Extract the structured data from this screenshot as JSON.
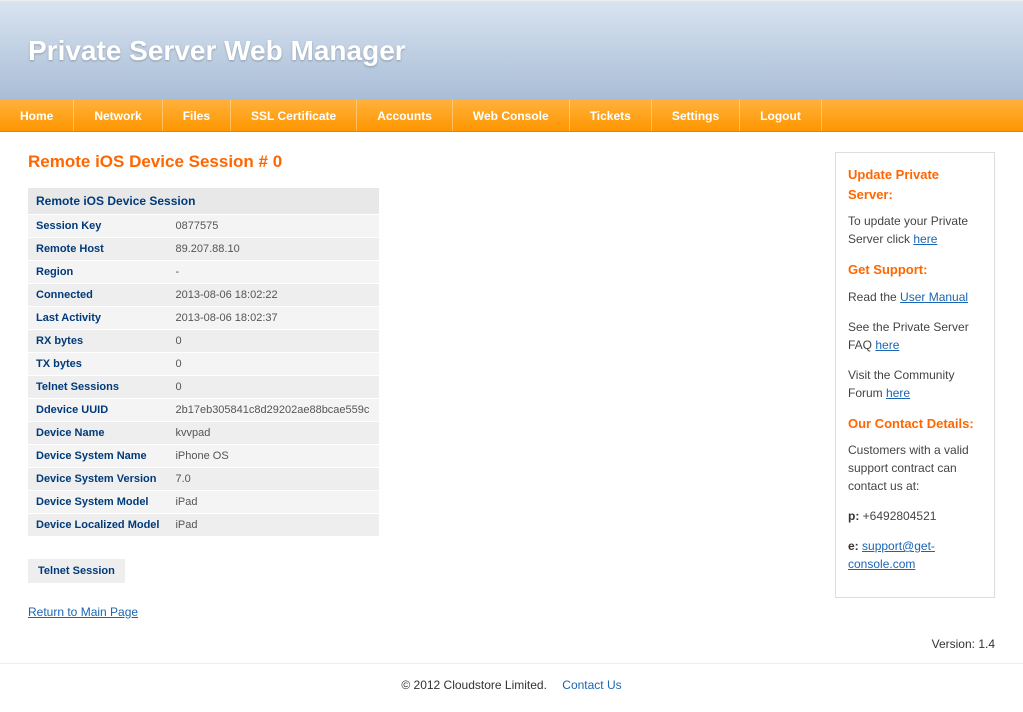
{
  "header": {
    "title": "Private Server Web Manager"
  },
  "nav": [
    "Home",
    "Network",
    "Files",
    "SSL Certificate",
    "Accounts",
    "Web Console",
    "Tickets",
    "Settings",
    "Logout"
  ],
  "page_heading": "Remote iOS Device Session # 0",
  "session_table": {
    "title": "Remote iOS Device Session",
    "rows": [
      {
        "k": "Session Key",
        "v": "0877575"
      },
      {
        "k": "Remote Host",
        "v": "89.207.88.10"
      },
      {
        "k": "Region",
        "v": "-"
      },
      {
        "k": "Connected",
        "v": "2013-08-06 18:02:22"
      },
      {
        "k": "Last Activity",
        "v": "2013-08-06 18:02:37"
      },
      {
        "k": "RX bytes",
        "v": "0"
      },
      {
        "k": "TX bytes",
        "v": "0"
      },
      {
        "k": "Telnet Sessions",
        "v": "0"
      },
      {
        "k": "Ddevice UUID",
        "v": "2b17eb305841c8d29202ae88bcae559c"
      },
      {
        "k": "Device Name",
        "v": "kvvpad"
      },
      {
        "k": "Device System Name",
        "v": "iPhone OS"
      },
      {
        "k": "Device System Version",
        "v": "7.0"
      },
      {
        "k": "Device System Model",
        "v": "iPad"
      },
      {
        "k": "Device Localized Model",
        "v": "iPad"
      }
    ]
  },
  "telnet_box": "Telnet Session",
  "return_link": "Return to Main Page",
  "sidebar": {
    "update_heading": "Update Private Server:",
    "update_text_pre": "To update your Private Server click ",
    "update_link": "here",
    "support_heading": "Get Support:",
    "support_manual_pre": "Read the ",
    "support_manual_link": "User Manual",
    "support_faq_pre": "See the Private Server FAQ ",
    "support_faq_link": "here",
    "support_forum_pre": "Visit the Community Forum ",
    "support_forum_link": "here",
    "contact_heading": "Our Contact Details:",
    "contact_intro": "Customers with a valid support contract can contact us at:",
    "phone_label": "p:",
    "phone_value": "+6492804521",
    "email_label": "e:",
    "email_value": "support@get-console.com"
  },
  "version": "Version: 1.4",
  "footer": {
    "copyright": "© 2012 Cloudstore Limited.",
    "contact_link": "Contact Us"
  }
}
